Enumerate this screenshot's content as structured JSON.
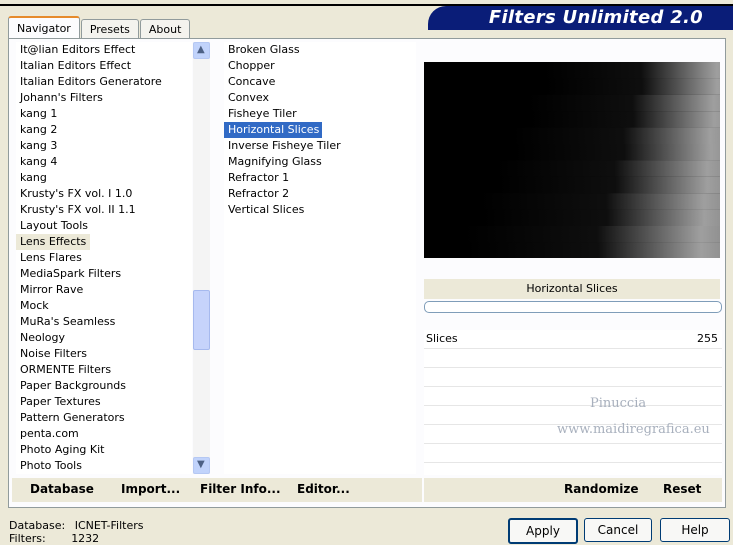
{
  "tabs": [
    "Navigator",
    "Presets",
    "About"
  ],
  "app_title": "Filters Unlimited 2.0",
  "categories": [
    "It@lian Editors Effect",
    "Italian Editors Effect",
    "Italian Editors Generatore",
    "Johann's Filters",
    "kang 1",
    "kang 2",
    "kang 3",
    "kang 4",
    "kang",
    "Krusty's FX vol. I 1.0",
    "Krusty's FX vol. II 1.1",
    "Layout Tools",
    "Lens Effects",
    "Lens Flares",
    "MediaSpark Filters",
    "Mirror Rave",
    "Mock",
    "MuRa's Seamless",
    "Neology",
    "Noise Filters",
    "ORMENTE Filters",
    "Paper Backgrounds",
    "Paper Textures",
    "Pattern Generators",
    "penta.com",
    "Photo Aging Kit",
    "Photo Tools"
  ],
  "selected_category": "Lens Effects",
  "filters": [
    "Broken Glass",
    "Chopper",
    "Concave",
    "Convex",
    "Fisheye Tiler",
    "Horizontal Slices",
    "Inverse Fisheye Tiler",
    "Magnifying Glass",
    "Refractor 1",
    "Refractor 2",
    "Vertical Slices"
  ],
  "selected_filter": "Horizontal Slices",
  "preview_label": "Horizontal Slices",
  "parameter": {
    "name": "Slices",
    "value": "255"
  },
  "left_buttons": {
    "database": "Database",
    "import": "Import...",
    "filter_info": "Filter Info...",
    "editor": "Editor..."
  },
  "right_buttons": {
    "randomize": "Randomize",
    "reset": "Reset"
  },
  "status": {
    "database_label": "Database:",
    "database_value": "ICNET-Filters",
    "filters_label": "Filters:",
    "filters_value": "1232"
  },
  "dialog_buttons": {
    "apply": "Apply",
    "cancel": "Cancel",
    "help": "Help"
  },
  "watermark": {
    "line1": "Pinuccia",
    "line2": "www.maidiregrafica.eu"
  },
  "colors": {
    "banner": "#0a1d78",
    "selection": "#316ac5",
    "tab_highlight": "#e68b2c"
  }
}
